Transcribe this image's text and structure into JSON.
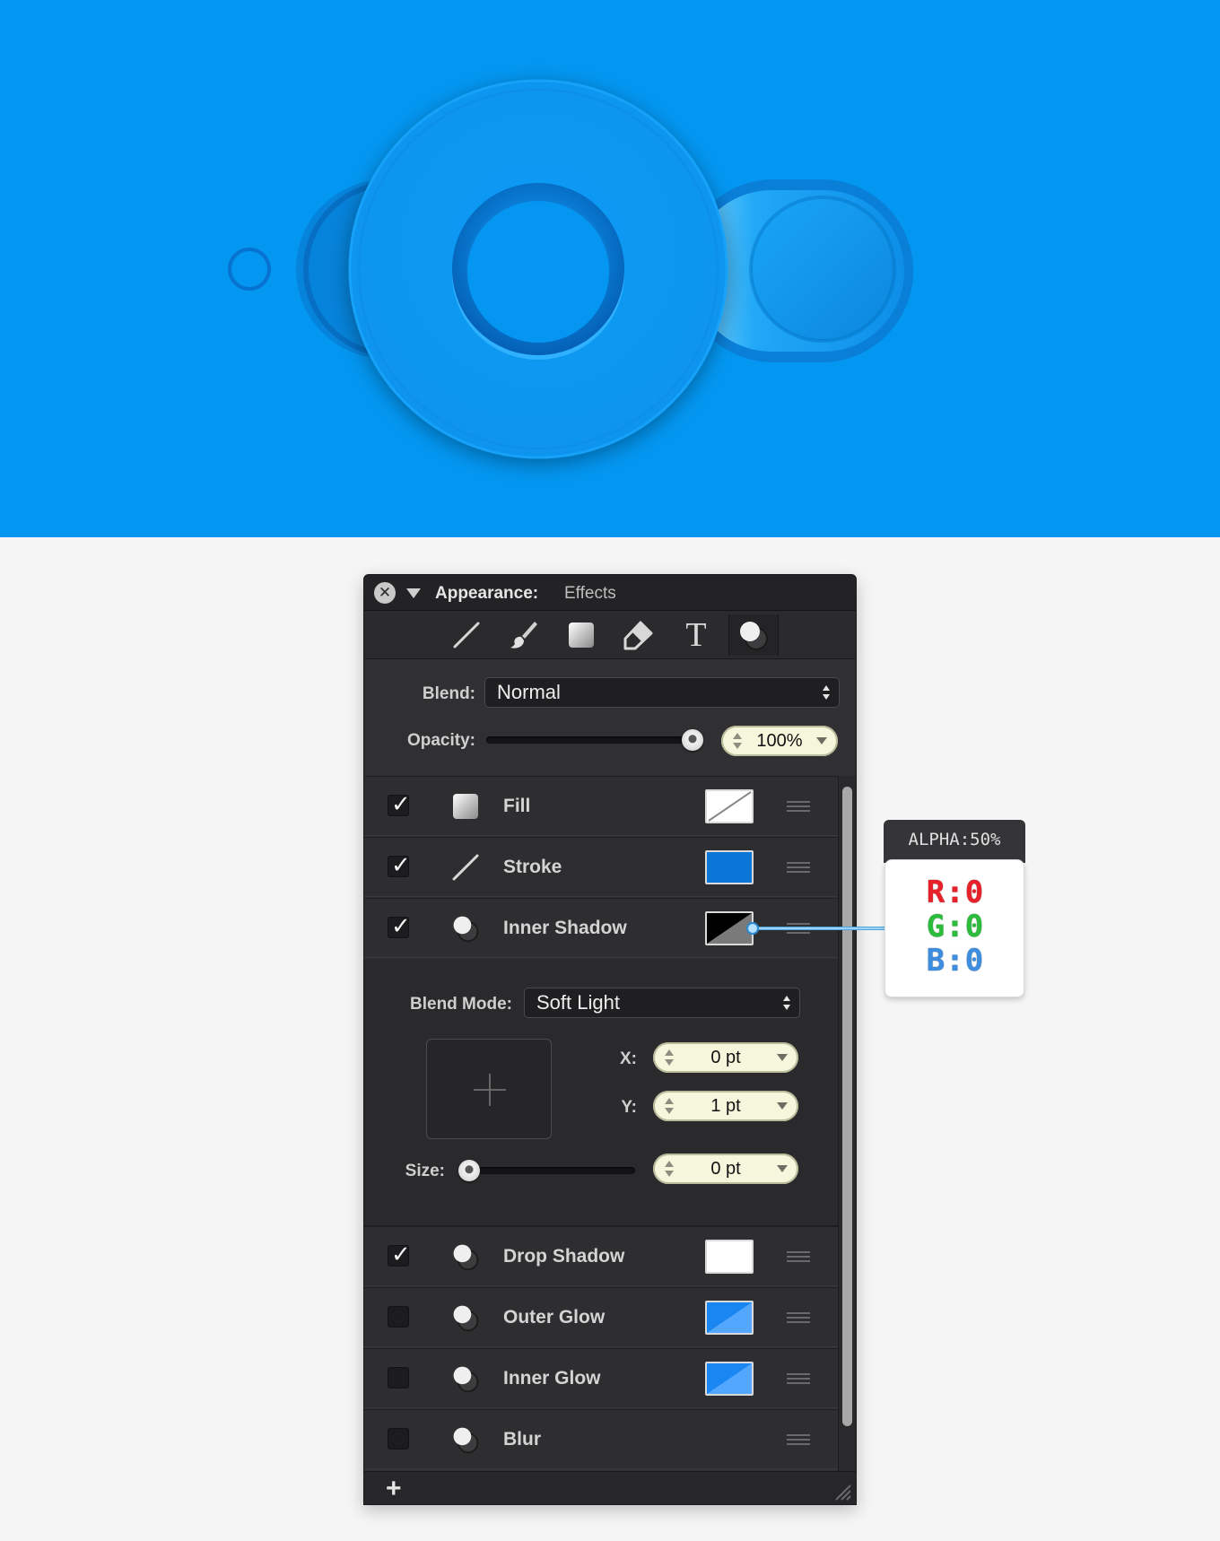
{
  "colors": {
    "canvas_blue": "#0397f2",
    "page_bg": "#f5f5f5",
    "panel_bg": "#303033",
    "stroke_swatch": "#0a77d8",
    "glow_swatch": "#1a86f2"
  },
  "panel": {
    "title_label": "Appearance:",
    "title_value": "Effects",
    "toolbar_tools": [
      "line-tool-icon",
      "brush-tool-icon",
      "fill-square-icon",
      "tag-icon",
      "text-tool-icon",
      "effects-icon"
    ],
    "toolbar_text_tool_glyph": "T",
    "blend_label": "Blend:",
    "blend_value": "Normal",
    "opacity_label": "Opacity:",
    "opacity_value": "100%",
    "opacity_level": 1.0,
    "effects": [
      {
        "name": "Fill",
        "checked": true,
        "icon": "fill-square-icon",
        "swatch": "transparent"
      },
      {
        "name": "Stroke",
        "checked": true,
        "icon": "line-tool-icon",
        "swatch": "#0a77d8"
      },
      {
        "name": "Inner Shadow",
        "checked": true,
        "icon": "effects-icon",
        "swatch": "black-half-alpha"
      },
      {
        "name": "Drop Shadow",
        "checked": true,
        "icon": "effects-icon",
        "swatch": "#ffffff"
      },
      {
        "name": "Outer Glow",
        "checked": false,
        "icon": "effects-icon",
        "swatch": "#1a86f2"
      },
      {
        "name": "Inner Glow",
        "checked": false,
        "icon": "effects-icon",
        "swatch": "#1a86f2"
      },
      {
        "name": "Blur",
        "checked": false,
        "icon": "effects-icon",
        "swatch": "none"
      }
    ],
    "tick_glyph": "✓",
    "detail": {
      "blend_mode_label": "Blend Mode:",
      "blend_mode_value": "Soft Light",
      "x_label": "X:",
      "x_value": "0 pt",
      "y_label": "Y:",
      "y_value": "1 pt",
      "size_label": "Size:",
      "size_value": "0 pt",
      "size_level": 0.0
    },
    "add_glyph": "+"
  },
  "callout": {
    "alpha_text": "ALPHA:50%",
    "r_text": "R:0",
    "g_text": "G:0",
    "b_text": "B:0"
  }
}
